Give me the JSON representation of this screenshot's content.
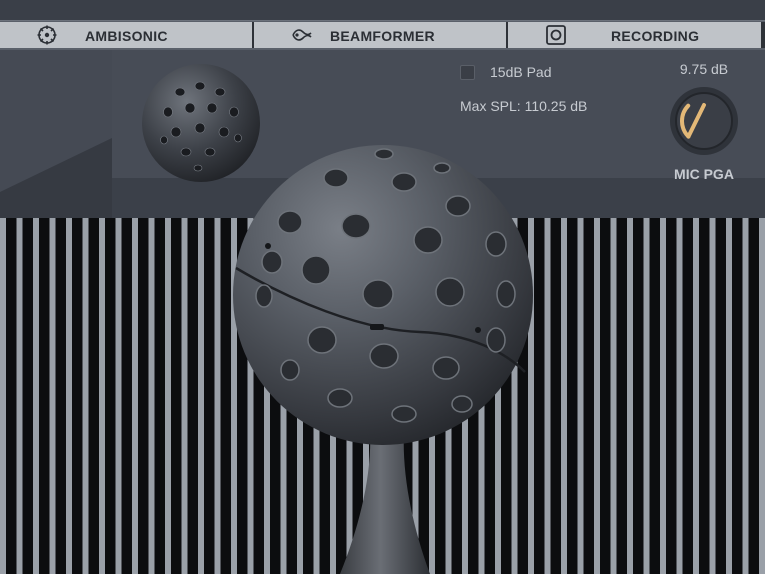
{
  "tabs": [
    {
      "label": "AMBISONIC",
      "icon": "ambisonic-icon"
    },
    {
      "label": "BEAMFORMER",
      "icon": "beamformer-icon"
    },
    {
      "label": "RECORDING",
      "icon": "recording-icon"
    }
  ],
  "controls": {
    "pad_label": "15dB Pad",
    "pad_checked": false,
    "max_spl": "Max SPL: 110.25 dB",
    "pga_value": "9.75 dB",
    "pga_label": "MIC PGA",
    "pga_fraction": 0.33
  },
  "colors": {
    "tab_bg": "#bfc3c8",
    "panel_bg": "#414650",
    "knob_accent": "#e3b877",
    "text": "#c7cbd1"
  }
}
